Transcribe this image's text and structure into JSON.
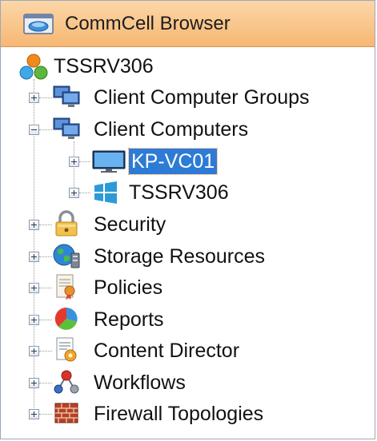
{
  "header": {
    "title": "CommCell Browser",
    "icon": "commcell-browser-icon"
  },
  "colors": {
    "header_top": "#fcd7a8",
    "header_bottom": "#f6b773",
    "selection": "#2d7bd6"
  },
  "tree": {
    "root": {
      "label": "TSSRV306",
      "icon": "commcell-icon"
    },
    "items": [
      {
        "label": "Client Computer Groups",
        "icon": "client-computer-groups-icon",
        "expanded": false
      },
      {
        "label": "Client Computers",
        "icon": "client-computers-icon",
        "expanded": true,
        "children": [
          {
            "label": "KP-VC01",
            "icon": "monitor-icon",
            "selected": true
          },
          {
            "label": "TSSRV306",
            "icon": "windows-icon"
          }
        ]
      },
      {
        "label": "Security",
        "icon": "lock-icon"
      },
      {
        "label": "Storage Resources",
        "icon": "storage-globe-icon"
      },
      {
        "label": "Policies",
        "icon": "policy-certificate-icon"
      },
      {
        "label": "Reports",
        "icon": "pie-chart-icon"
      },
      {
        "label": "Content Director",
        "icon": "content-director-icon"
      },
      {
        "label": "Workflows",
        "icon": "workflow-icon"
      },
      {
        "label": "Firewall Topologies",
        "icon": "firewall-icon"
      }
    ]
  }
}
